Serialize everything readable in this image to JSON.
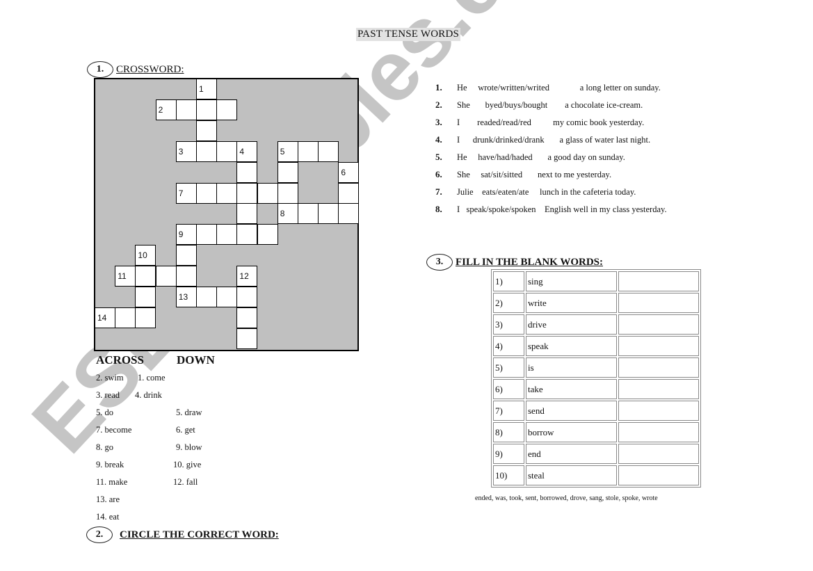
{
  "title": "PAST TENSE WORDS",
  "section1": {
    "number": "1.",
    "title": "CROSSWORD:",
    "crossword": {
      "cells": [
        {
          "c": 5,
          "r": 0,
          "n": "1"
        },
        {
          "c": 3,
          "r": 1,
          "n": "2"
        },
        {
          "c": 4,
          "r": 1
        },
        {
          "c": 5,
          "r": 1
        },
        {
          "c": 6,
          "r": 1
        },
        {
          "c": 5,
          "r": 2
        },
        {
          "c": 4,
          "r": 3,
          "n": "3"
        },
        {
          "c": 5,
          "r": 3
        },
        {
          "c": 6,
          "r": 3
        },
        {
          "c": 7,
          "r": 3,
          "n": "4"
        },
        {
          "c": 9,
          "r": 3,
          "n": "5"
        },
        {
          "c": 10,
          "r": 3
        },
        {
          "c": 11,
          "r": 3
        },
        {
          "c": 7,
          "r": 4
        },
        {
          "c": 9,
          "r": 4
        },
        {
          "c": 12,
          "r": 4,
          "n": "6"
        },
        {
          "c": 4,
          "r": 5,
          "n": "7"
        },
        {
          "c": 5,
          "r": 5
        },
        {
          "c": 6,
          "r": 5
        },
        {
          "c": 7,
          "r": 5
        },
        {
          "c": 8,
          "r": 5
        },
        {
          "c": 9,
          "r": 5
        },
        {
          "c": 12,
          "r": 5
        },
        {
          "c": 7,
          "r": 6
        },
        {
          "c": 9,
          "r": 6,
          "n": "8"
        },
        {
          "c": 10,
          "r": 6
        },
        {
          "c": 11,
          "r": 6
        },
        {
          "c": 12,
          "r": 6
        },
        {
          "c": 4,
          "r": 7,
          "n": "9"
        },
        {
          "c": 5,
          "r": 7
        },
        {
          "c": 6,
          "r": 7
        },
        {
          "c": 7,
          "r": 7
        },
        {
          "c": 8,
          "r": 7
        },
        {
          "c": 2,
          "r": 8,
          "n": "10"
        },
        {
          "c": 4,
          "r": 8
        },
        {
          "c": 1,
          "r": 9,
          "n": "11"
        },
        {
          "c": 2,
          "r": 9
        },
        {
          "c": 3,
          "r": 9
        },
        {
          "c": 4,
          "r": 9
        },
        {
          "c": 7,
          "r": 9,
          "n": "12"
        },
        {
          "c": 2,
          "r": 10
        },
        {
          "c": 4,
          "r": 10,
          "n": "13"
        },
        {
          "c": 5,
          "r": 10
        },
        {
          "c": 6,
          "r": 10
        },
        {
          "c": 7,
          "r": 10
        },
        {
          "c": 0,
          "r": 11,
          "n": "14"
        },
        {
          "c": 1,
          "r": 11
        },
        {
          "c": 2,
          "r": 11
        },
        {
          "c": 7,
          "r": 11
        },
        {
          "c": 7,
          "r": 12
        }
      ]
    },
    "across_label": "ACROSS",
    "down_label": "DOWN",
    "clue_rows": [
      [
        "2. swim",
        "1. come"
      ],
      [
        "3. read",
        "4. drink"
      ],
      [
        "5. do",
        "5. draw"
      ],
      [
        "7. become",
        "6. get"
      ],
      [
        "8. go",
        "9. blow"
      ],
      [
        "9. break",
        "10. give"
      ],
      [
        "11. make",
        "12. fall"
      ],
      [
        "13. are",
        ""
      ],
      [
        "14. eat",
        ""
      ]
    ]
  },
  "section2": {
    "number": "2.",
    "title": "CIRCLE THE CORRECT WORD:",
    "sentences": [
      {
        "num": "1.",
        "text": "He     wrote/written/writed              a long letter on sunday."
      },
      {
        "num": "2.",
        "text": "She       byed/buys/bought        a chocolate ice-cream."
      },
      {
        "num": "3.",
        "text": "I        readed/read/red          my comic book yesterday."
      },
      {
        "num": "4.",
        "text": "I      drunk/drinked/drank       a glass of water last night."
      },
      {
        "num": "5.",
        "text": "He     have/had/haded       a good day on sunday."
      },
      {
        "num": "6.",
        "text": "She     sat/sit/sitted       next to me yesterday."
      },
      {
        "num": "7.",
        "text": "Julie    eats/eaten/ate     lunch in the cafeteria today."
      },
      {
        "num": "8.",
        "text": "I   speak/spoke/spoken    English well in my class yesterday."
      }
    ]
  },
  "section3": {
    "number": "3.",
    "title": "FILL IN THE BLANK WORDS:",
    "rows": [
      {
        "num": "1)",
        "word": "sing",
        "answer": ""
      },
      {
        "num": "2)",
        "word": "write",
        "answer": ""
      },
      {
        "num": "3)",
        "word": "drive",
        "answer": ""
      },
      {
        "num": "4)",
        "word": "speak",
        "answer": ""
      },
      {
        "num": "5)",
        "word": "is",
        "answer": ""
      },
      {
        "num": "6)",
        "word": "take",
        "answer": ""
      },
      {
        "num": "7)",
        "word": "send",
        "answer": ""
      },
      {
        "num": "8)",
        "word": "borrow",
        "answer": ""
      },
      {
        "num": "9)",
        "word": "end",
        "answer": ""
      },
      {
        "num": "10)",
        "word": "steal",
        "answer": ""
      }
    ],
    "word_bank": "ended, was, took, sent, borrowed, drove, sang, stole, spoke, wrote"
  },
  "watermark": "ESLprintables.com"
}
